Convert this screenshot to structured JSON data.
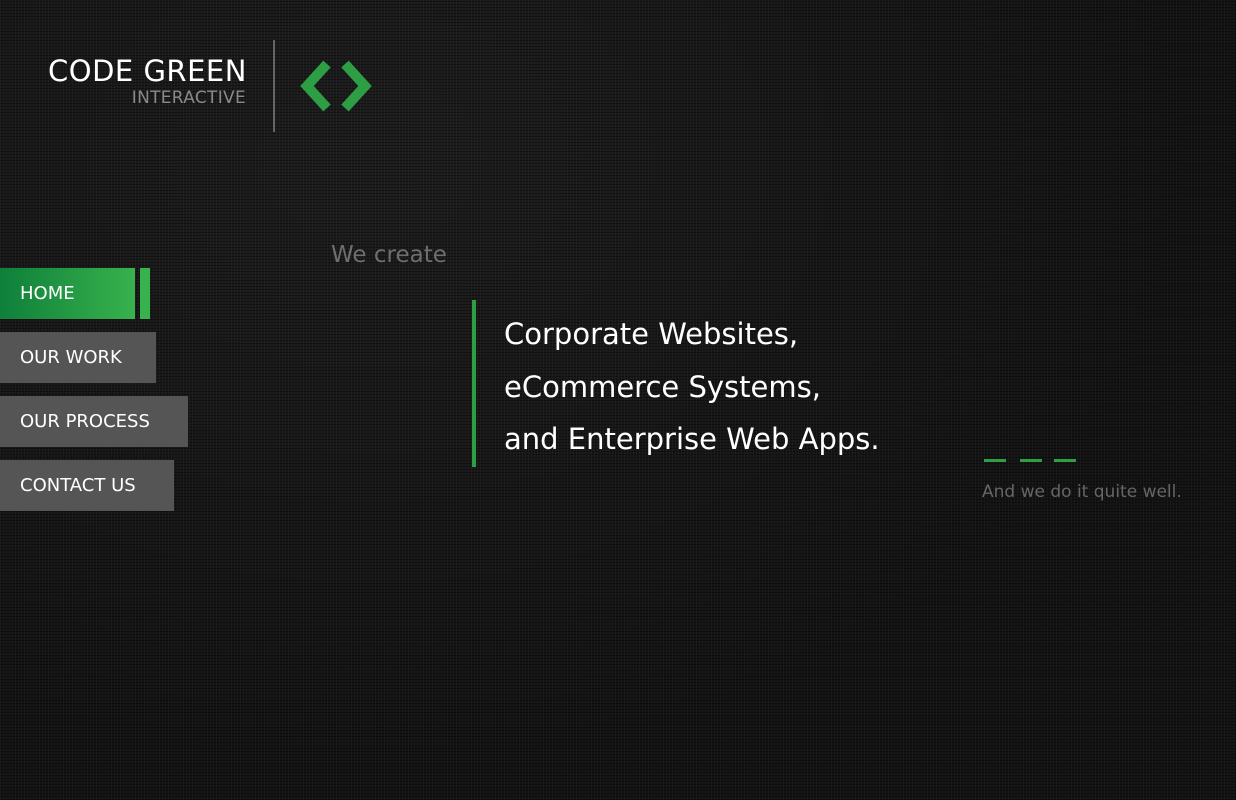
{
  "logo": {
    "title": "CODE GREEN",
    "subtitle": "INTERACTIVE",
    "icon": "code-brackets-icon",
    "accent_color": "#2e9e44"
  },
  "nav": {
    "items": [
      {
        "label": "HOME",
        "active": true
      },
      {
        "label": "OUR WORK",
        "active": false
      },
      {
        "label": "OUR PROCESS",
        "active": false
      },
      {
        "label": "CONTACT US",
        "active": false
      }
    ],
    "active_color": "#37b24d",
    "inactive_color": "#555555"
  },
  "hero": {
    "intro": "We create",
    "lines": [
      "Corporate Websites,",
      "eCommerce Systems,",
      "and Enterprise Web Apps."
    ]
  },
  "tagline": {
    "text": "And we do it quite well."
  }
}
